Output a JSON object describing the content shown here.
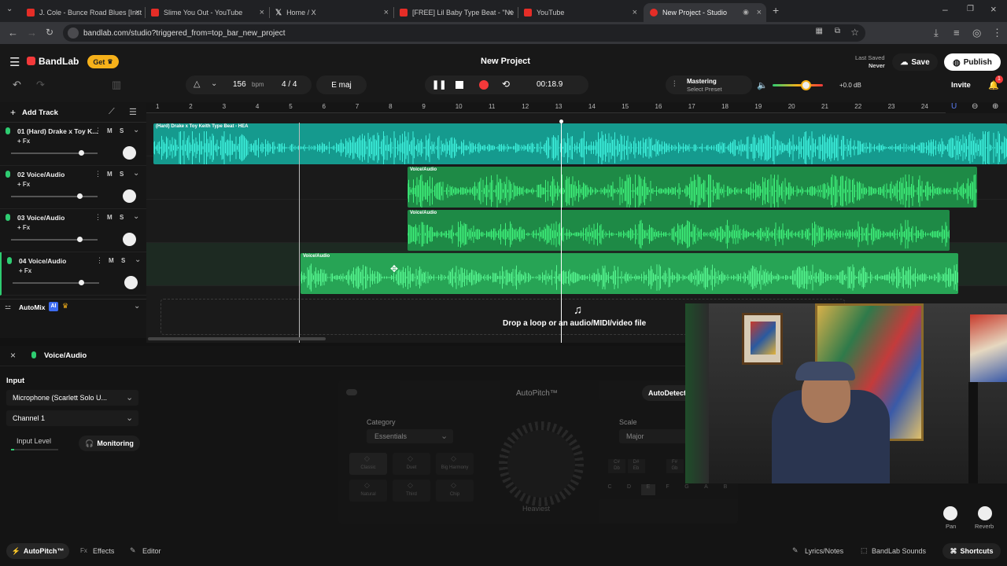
{
  "browser": {
    "tabs": [
      {
        "title": "J. Cole - Bunce Road Blues [Inst",
        "fav": "#e52d27"
      },
      {
        "title": "Slime You Out - YouTube",
        "fav": "#e52d27"
      },
      {
        "title": "Home / X",
        "fav": "#111111"
      },
      {
        "title": "[FREE] Lil Baby Type Beat - \"Ne",
        "fav": "#e52d27"
      },
      {
        "title": "YouTube",
        "fav": "#e52d27"
      },
      {
        "title": "New Project - Studio",
        "fav": "#e52d27"
      }
    ],
    "url": "bandlab.com/studio?triggered_from=top_bar_new_project"
  },
  "header": {
    "logo": "BandLab",
    "get_label": "Get",
    "project_title": "New Project",
    "last_saved_label": "Last Saved",
    "last_saved_value": "Never",
    "save_label": "Save",
    "publish_label": "Publish",
    "bpm_value": "156",
    "bpm_unit": "bpm",
    "time_sig": "4 / 4",
    "key": "E maj",
    "time": "00:18.9",
    "mastering_label": "Mastering",
    "mastering_preset": "Select Preset",
    "volume_db": "+0.0 dB",
    "invite_label": "Invite",
    "notification_count": "1"
  },
  "tracks": {
    "add_label": "Add Track",
    "items": [
      {
        "name": "01  (Hard) Drake x Toy K...",
        "fx": "+ Fx",
        "vol": 0.82
      },
      {
        "name": "02  Voice/Audio",
        "fx": "+ Fx",
        "vol": 0.8
      },
      {
        "name": "03  Voice/Audio",
        "fx": "+ Fx",
        "vol": 0.8
      },
      {
        "name": "04  Voice/Audio",
        "fx": "+ Fx",
        "vol": 0.8
      }
    ],
    "automix_label": "AutoMix",
    "automix_badge": "AI",
    "mute": "M",
    "solo": "S"
  },
  "ruler": [
    "1",
    "2",
    "3",
    "4",
    "5",
    "6",
    "7",
    "8",
    "9",
    "10",
    "11",
    "12",
    "13",
    "14",
    "15",
    "16",
    "17",
    "18",
    "19",
    "20",
    "21",
    "22",
    "23",
    "24"
  ],
  "clips": {
    "track1": "(Hard) Drake x Toy Keith Type Beat - HEA",
    "voice": "Voice/Audio"
  },
  "drop_hint": "Drop a loop or an audio/MIDI/video file",
  "bottom": {
    "panel_title": "Voice/Audio",
    "input_label": "Input",
    "input_device": "Microphone (Scarlett Solo U...",
    "channel": "Channel 1",
    "input_level_label": "Input Level",
    "monitoring_label": "Monitoring",
    "autopitch_title": "AutoPitch™",
    "autodetect_label": "AutoDetect",
    "category_label": "Category",
    "category_value": "Essentials",
    "scale_label": "Scale",
    "scale_value": "Major",
    "presets": [
      "Classic",
      "Duet",
      "Big Harmony",
      "Natural",
      "Third",
      "Chip"
    ],
    "knob_label": "Heaviest",
    "pan_label": "Pan",
    "reverb_label": "Reverb",
    "notes": [
      "C",
      "D",
      "E",
      "F",
      "G",
      "A",
      "B"
    ],
    "sharps": [
      "C#\nDb",
      "D#\nEb",
      "F#\nGb"
    ]
  },
  "footer": {
    "autopitch": "AutoPitch™",
    "effects": "Effects",
    "editor": "Editor",
    "lyrics": "Lyrics/Notes",
    "sounds": "BandLab Sounds",
    "shortcuts": "Shortcuts"
  },
  "colors": {
    "accent": "#f3393a",
    "teal": "#1ec6b0",
    "green": "#2ecc71",
    "gold": "#f6b11a"
  }
}
